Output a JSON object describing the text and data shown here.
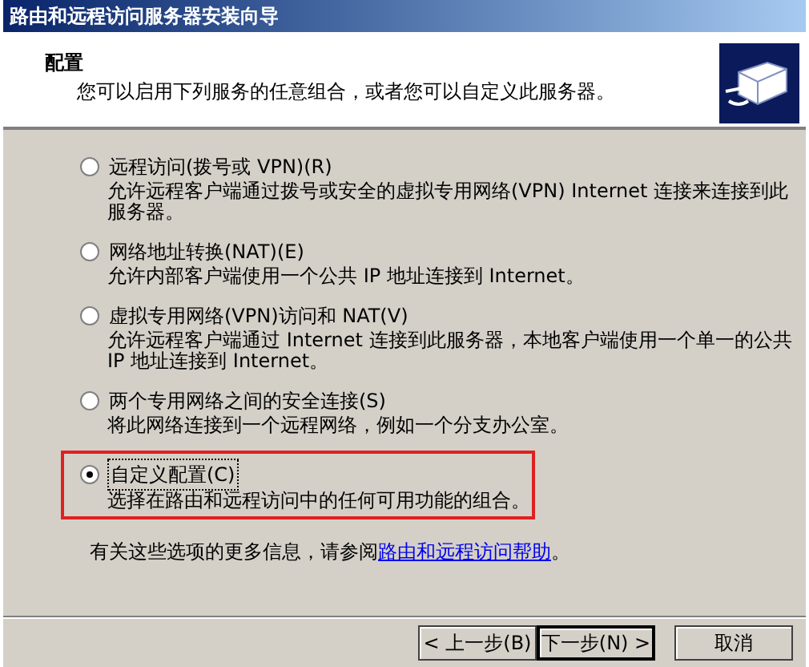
{
  "window": {
    "title": "路由和远程访问服务器安装向导"
  },
  "header": {
    "title": "配置",
    "subtitle": "您可以启用下列服务的任意组合，或者您可以自定义此服务器。"
  },
  "options": [
    {
      "label": "远程访问(拨号或 VPN)(R)",
      "description": "允许远程客户端通过拨号或安全的虚拟专用网络(VPN) Internet 连接来连接到此服务器。",
      "selected": false,
      "highlighted": false
    },
    {
      "label": "网络地址转换(NAT)(E)",
      "description": "允许内部客户端使用一个公共 IP 地址连接到 Internet。",
      "selected": false,
      "highlighted": false
    },
    {
      "label": "虚拟专用网络(VPN)访问和 NAT(V)",
      "description": "允许远程客户端通过 Internet 连接到此服务器，本地客户端使用一个单一的公共 IP 地址连接到 Internet。",
      "selected": false,
      "highlighted": false
    },
    {
      "label": "两个专用网络之间的安全连接(S)",
      "description": "将此网络连接到一个远程网络，例如一个分支办公室。",
      "selected": false,
      "highlighted": false
    },
    {
      "label": "自定义配置(C)",
      "description": "选择在路由和远程访问中的任何可用功能的组合。",
      "selected": true,
      "highlighted": true
    }
  ],
  "help": {
    "text": "有关这些选项的更多信息，请参阅",
    "link": "路由和远程访问帮助",
    "end": "。"
  },
  "buttons": [
    {
      "label": "< 上一步(B)",
      "default": false
    },
    {
      "label": "下一步(N) >",
      "default": true
    },
    {
      "label": "取消",
      "default": false
    }
  ]
}
